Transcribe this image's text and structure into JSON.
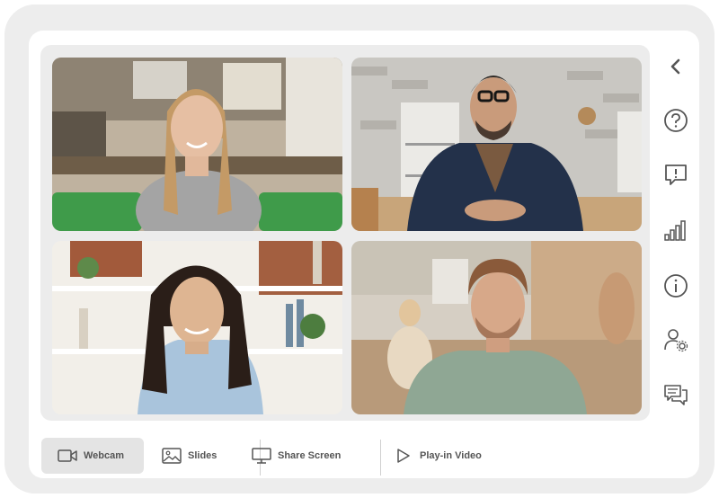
{
  "toolbar": {
    "webcam_label": "Webcam",
    "slides_label": "Slides",
    "share_label": "Share Screen",
    "video_label": "Play-in Video",
    "active": "webcam"
  },
  "sidebar": {
    "icons": [
      "chevron-left-icon",
      "help-icon",
      "feedback-icon",
      "signal-bars-icon",
      "info-icon",
      "user-settings-icon",
      "chat-icon"
    ]
  },
  "participants": [
    {
      "tile": 1,
      "description": "woman in kitchen"
    },
    {
      "tile": 2,
      "description": "man in blazer"
    },
    {
      "tile": 3,
      "description": "woman by bookshelf"
    },
    {
      "tile": 4,
      "description": "man in office"
    }
  ],
  "colors": {
    "device_bg": "#ededed",
    "stage_bg": "#ececec",
    "icon": "#555555",
    "active_tool_bg": "#e4e4e4"
  }
}
